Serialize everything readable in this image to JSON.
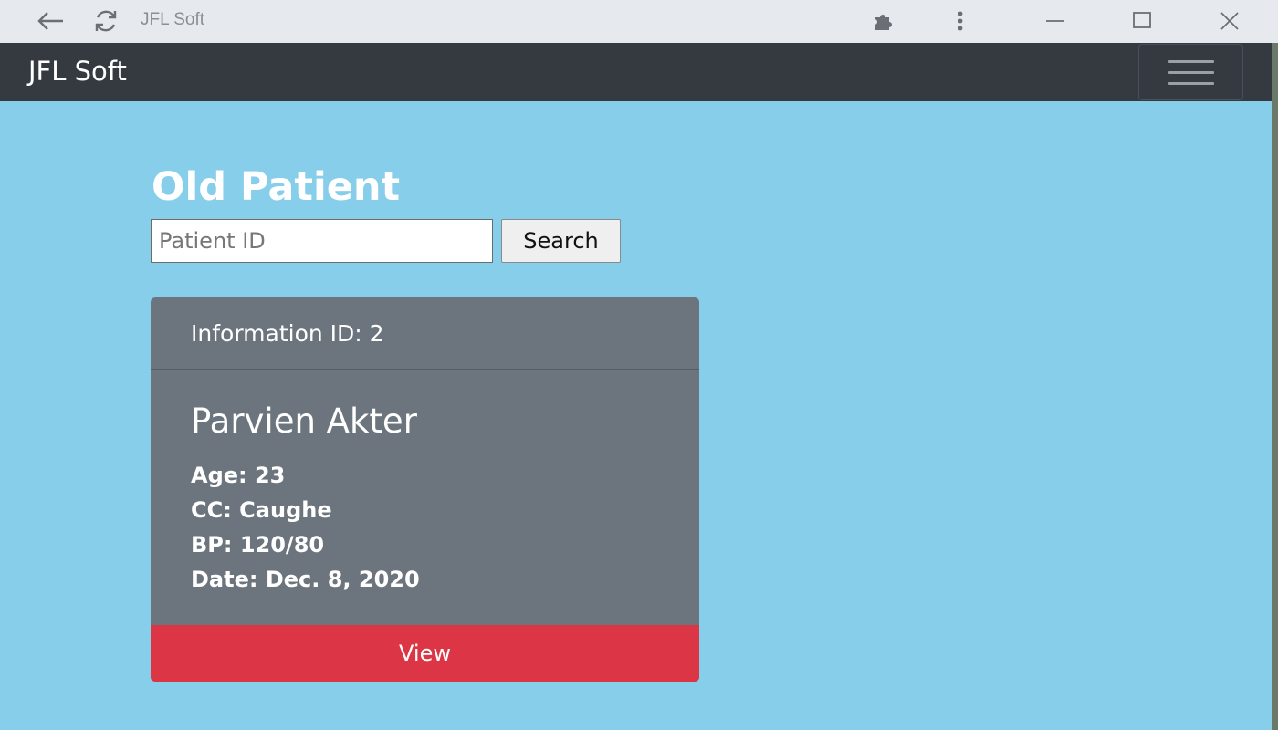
{
  "browser": {
    "tab_title": "JFL Soft",
    "icons": [
      "back-icon",
      "reload-icon",
      "extensions-icon",
      "more-icon",
      "minimize-icon",
      "maximize-icon",
      "close-icon"
    ]
  },
  "navbar": {
    "brand": "JFL Soft",
    "toggler_icon": "hamburger-icon",
    "background": "#343a40"
  },
  "page": {
    "heading": "Old Patient",
    "background": "#87ceeb"
  },
  "search": {
    "placeholder": "Patient ID",
    "value": "",
    "button_label": "Search"
  },
  "card": {
    "header": "Information ID: 2",
    "name": "Parvien Akter",
    "details": [
      "Age: 23",
      "CC: Caughe",
      "BP: 120/80",
      "Date: Dec. 8, 2020"
    ],
    "action_label": "View",
    "colors": {
      "card": "#6c757d",
      "action": "#dc3545"
    }
  }
}
